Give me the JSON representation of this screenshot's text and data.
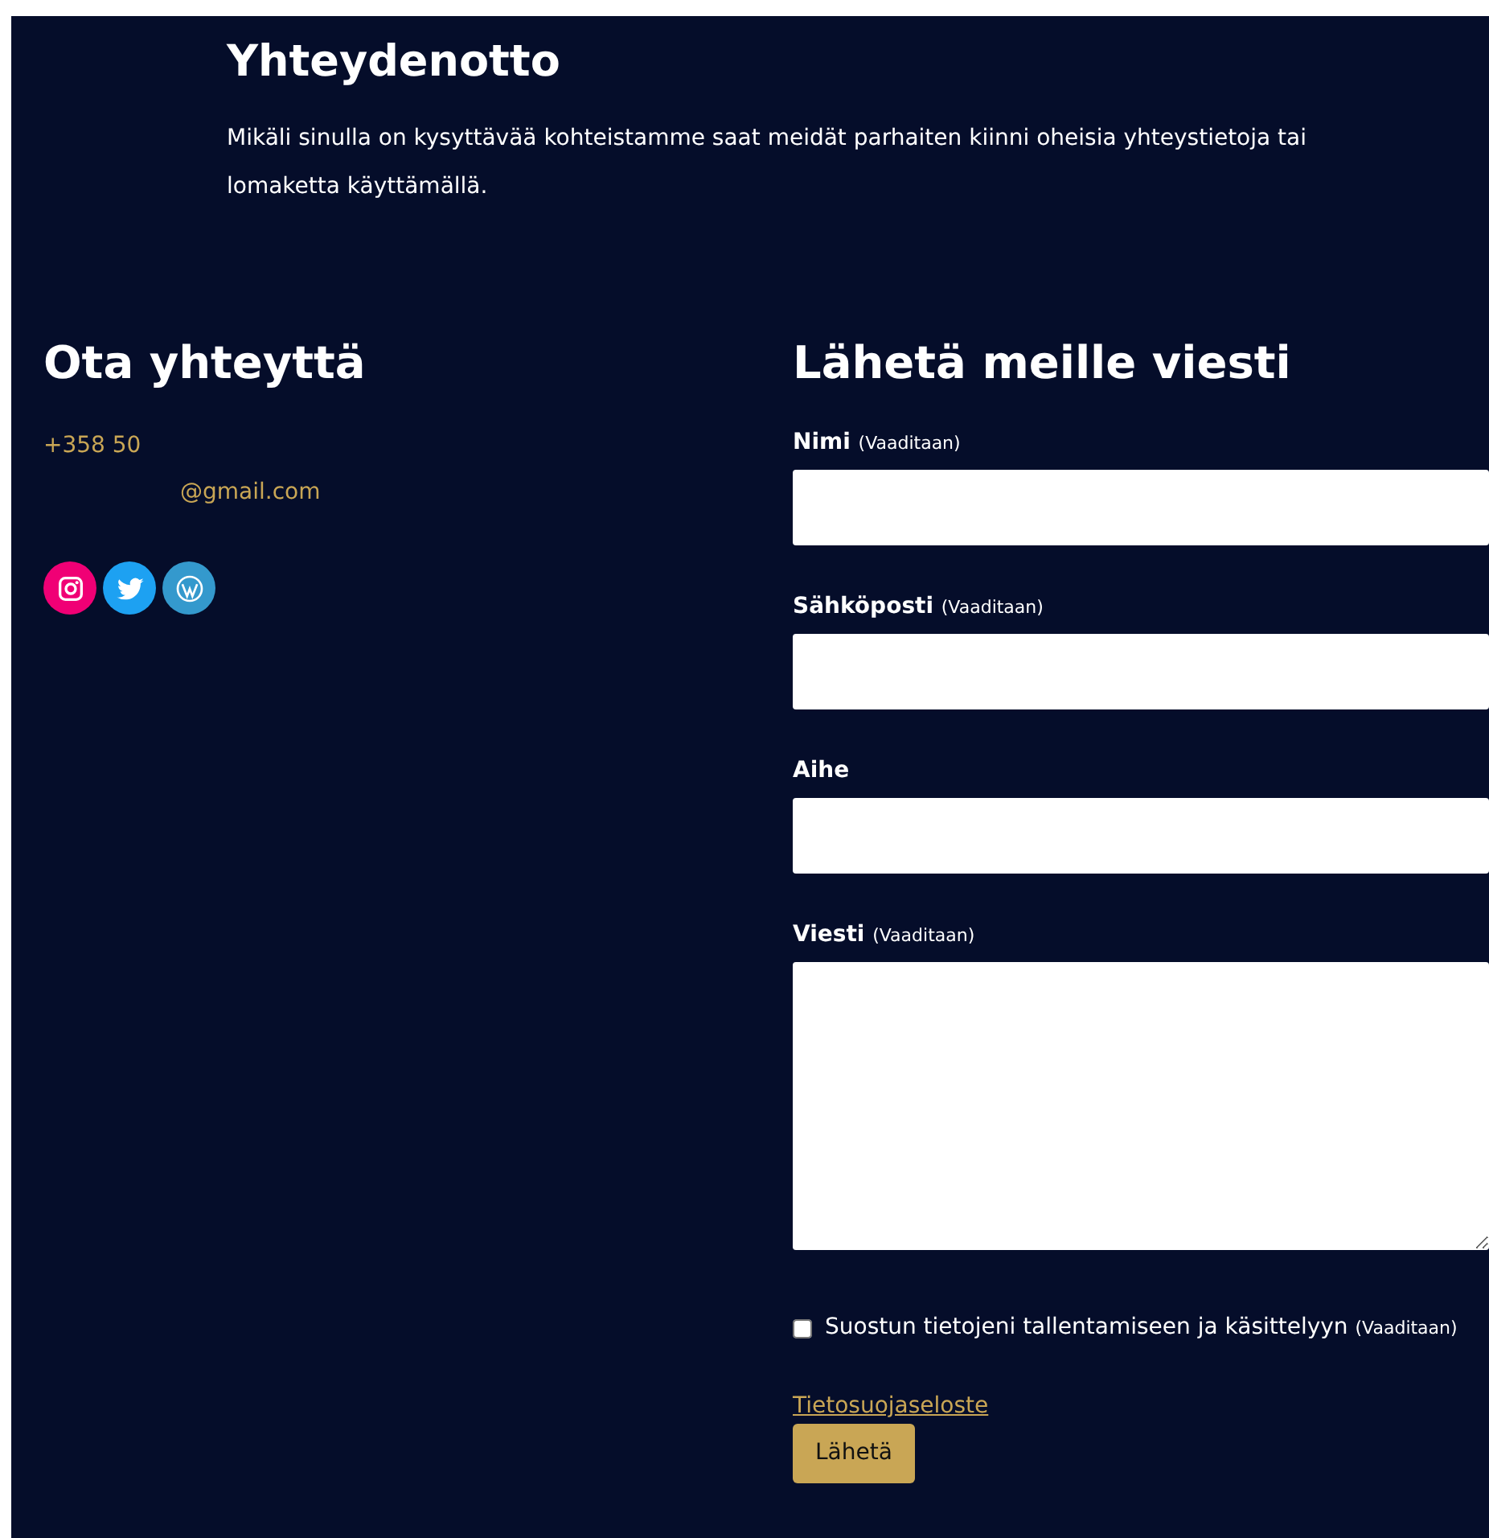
{
  "intro": {
    "title": "Yhteydenotto",
    "text": "Mikäli sinulla on kysyttävää kohteistamme saat meidät parhaiten kiinni oheisia yhteystietoja tai lomaketta käyttämällä."
  },
  "contact": {
    "title": "Ota yhteyttä",
    "phone": "+358 50",
    "email": "@gmail.com",
    "social": [
      {
        "kind": "instagram",
        "color": "#f00075"
      },
      {
        "kind": "twitter",
        "color": "#1da1f2"
      },
      {
        "kind": "wordpress",
        "color": "#3499cd"
      }
    ]
  },
  "form": {
    "title": "Lähetä meille viesti",
    "fields": [
      {
        "kind": "text",
        "label": "Nimi",
        "note": "(Vaaditaan)"
      },
      {
        "kind": "text",
        "label": "Sähköposti",
        "note": "(Vaaditaan)"
      },
      {
        "kind": "text",
        "label": "Aihe"
      },
      {
        "kind": "textarea",
        "label": "Viesti",
        "note": "(Vaaditaan)"
      }
    ],
    "consent": {
      "label": "Suostun tietojeni tallentamiseen ja käsittelyyn",
      "note": "(Vaaditaan)",
      "checked": false
    },
    "privacy_link": "Tietosuojaseloste",
    "submit": "Lähetä"
  }
}
